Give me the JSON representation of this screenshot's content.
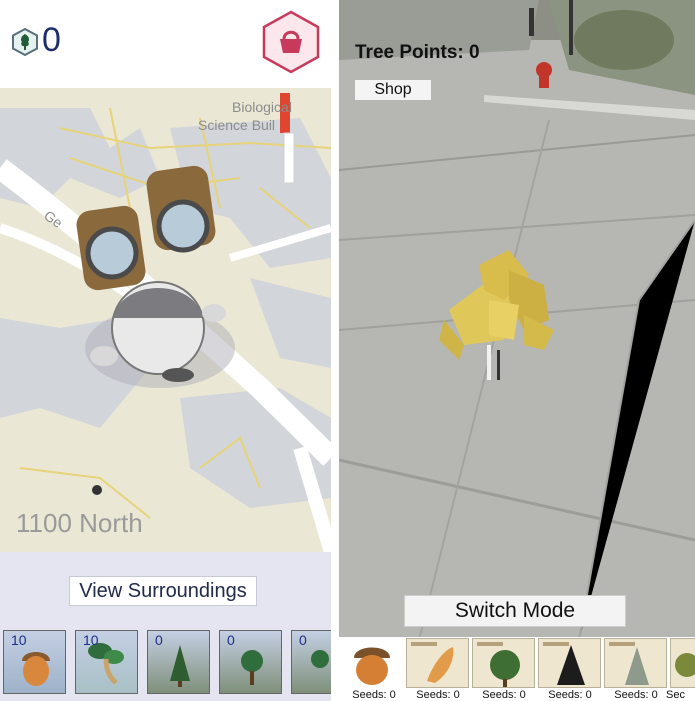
{
  "map_mode": {
    "points_icon": "tree-hexagon-icon",
    "points_value": "0",
    "shop_icon": "shopping-basket-hexagon-icon",
    "map": {
      "labels": [
        "Biological",
        "Science Buil",
        "Ge",
        "1100 North"
      ]
    },
    "view_button": "View Surroundings",
    "inventory": [
      {
        "count": "10",
        "icon": "acorn-icon"
      },
      {
        "count": "10",
        "icon": "sprout-icon"
      },
      {
        "count": "0",
        "icon": "pine-tree-icon"
      },
      {
        "count": "0",
        "icon": "leafy-tree-icon"
      },
      {
        "count": "0",
        "icon": "tree-icon"
      }
    ]
  },
  "ar_mode": {
    "tree_points": "Tree Points: 0",
    "shop_button": "Shop",
    "switch_button": "Switch Mode",
    "seed_cards": [
      {
        "icon": "acorn-icon",
        "seeds": "Seeds: 0"
      },
      {
        "icon": "leaf-card-icon",
        "seeds": "Seeds: 0"
      },
      {
        "icon": "round-tree-card-icon",
        "seeds": "Seeds: 0"
      },
      {
        "icon": "conifer-card-icon",
        "seeds": "Seeds: 0"
      },
      {
        "icon": "spruce-card-icon",
        "seeds": "Seeds: 0"
      },
      {
        "icon": "tree-card-icon",
        "seeds": "Sec"
      }
    ]
  },
  "colors": {
    "accent_pink": "#c83a5c",
    "ui_navy": "#1c2f6a",
    "tray_lavender": "#e5e4f1"
  }
}
